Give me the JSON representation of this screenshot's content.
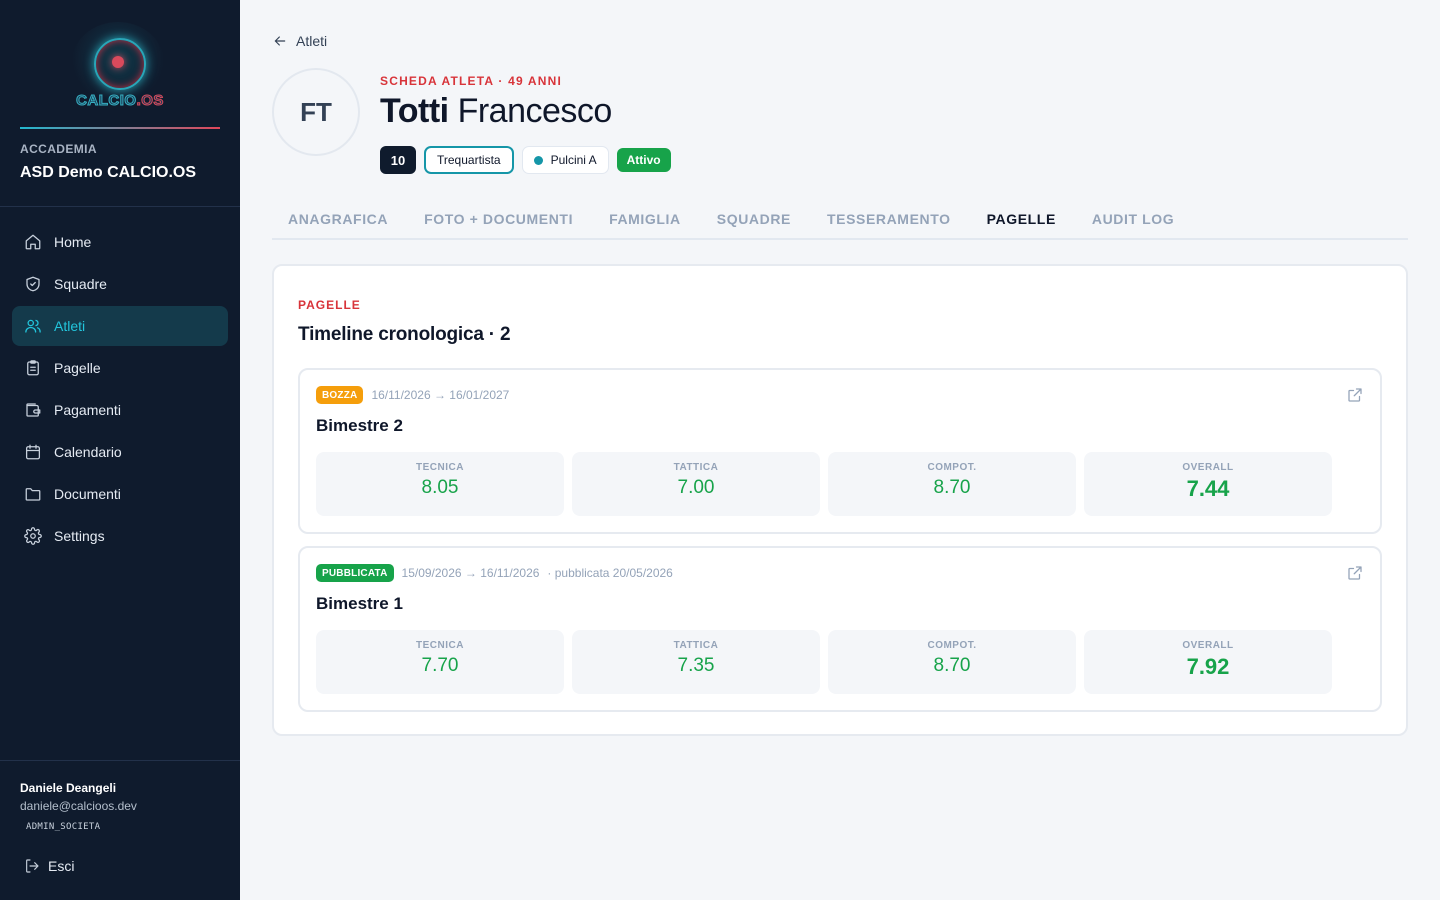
{
  "sidebar": {
    "logo_text": "CALCIO",
    "logo_text_suffix": ".OS",
    "academy_label": "ACCADEMIA",
    "academy_name": "ASD Demo CALCIO.OS",
    "nav": [
      {
        "label": "Home",
        "icon": "home-icon"
      },
      {
        "label": "Squadre",
        "icon": "shield-icon"
      },
      {
        "label": "Atleti",
        "icon": "users-icon",
        "active": true
      },
      {
        "label": "Pagelle",
        "icon": "clipboard-icon"
      },
      {
        "label": "Pagamenti",
        "icon": "wallet-icon"
      },
      {
        "label": "Calendario",
        "icon": "calendar-icon"
      },
      {
        "label": "Documenti",
        "icon": "folder-icon"
      },
      {
        "label": "Settings",
        "icon": "gear-icon"
      }
    ],
    "user": {
      "name": "Daniele Deangeli",
      "email": "daniele@calcioos.dev",
      "role": "ADMIN_SOCIETA"
    },
    "logout_label": "Esci"
  },
  "header": {
    "back_label": "Atleti",
    "initials": "FT",
    "kicker": "SCHEDA ATLETA · 49 ANNI",
    "surname": "Totti",
    "firstname": "Francesco",
    "badges": {
      "number": "10",
      "role": "Trequartista",
      "team": "Pulcini A",
      "status": "Attivo"
    }
  },
  "tabs": [
    {
      "label": "ANAGRAFICA"
    },
    {
      "label": "FOTO + DOCUMENTI"
    },
    {
      "label": "FAMIGLIA"
    },
    {
      "label": "SQUADRE"
    },
    {
      "label": "TESSERAMENTO"
    },
    {
      "label": "PAGELLE",
      "active": true
    },
    {
      "label": "AUDIT LOG"
    }
  ],
  "pagelle": {
    "kicker": "PAGELLE",
    "title": "Timeline cronologica · 2",
    "entries": [
      {
        "status": "BOZZA",
        "period": "16/11/2026 → 16/01/2027",
        "published": "",
        "title": "Bimestre 2",
        "scores": [
          {
            "label": "TECNICA",
            "value": "8.05"
          },
          {
            "label": "TATTICA",
            "value": "7.00"
          },
          {
            "label": "COMPOT.",
            "value": "8.70"
          },
          {
            "label": "OVERALL",
            "value": "7.44"
          }
        ]
      },
      {
        "status": "PUBBLICATA",
        "period": "15/09/2026 → 16/11/2026",
        "published": "· pubblicata 20/05/2026",
        "title": "Bimestre 1",
        "scores": [
          {
            "label": "TECNICA",
            "value": "7.70"
          },
          {
            "label": "TATTICA",
            "value": "7.35"
          },
          {
            "label": "COMPOT.",
            "value": "8.70"
          },
          {
            "label": "OVERALL",
            "value": "7.92"
          }
        ]
      }
    ]
  },
  "colors": {
    "sidebar_bg": "#0f1b2d",
    "accent_teal": "#22c5dc",
    "accent_red": "#d8343a",
    "success_green": "#17a34a",
    "draft_amber": "#f59e0b"
  }
}
